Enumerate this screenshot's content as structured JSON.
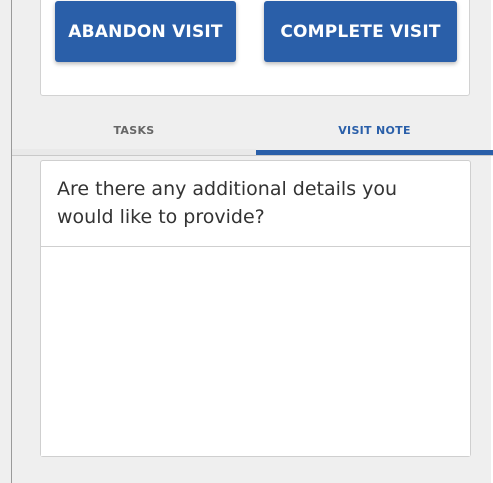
{
  "actions": {
    "abandon_label": "ABANDON VISIT",
    "complete_label": "COMPLETE VISIT"
  },
  "tabs": [
    {
      "label": "TASKS",
      "active": false
    },
    {
      "label": "VISIT NOTE",
      "active": true
    }
  ],
  "visit_note": {
    "question": "Are there any additional details you would like to provide?",
    "value": "",
    "placeholder": ""
  },
  "colors": {
    "accent": "#2a5fa9",
    "background": "#efefef",
    "card": "#ffffff",
    "inactive_tab_text": "#666666"
  }
}
